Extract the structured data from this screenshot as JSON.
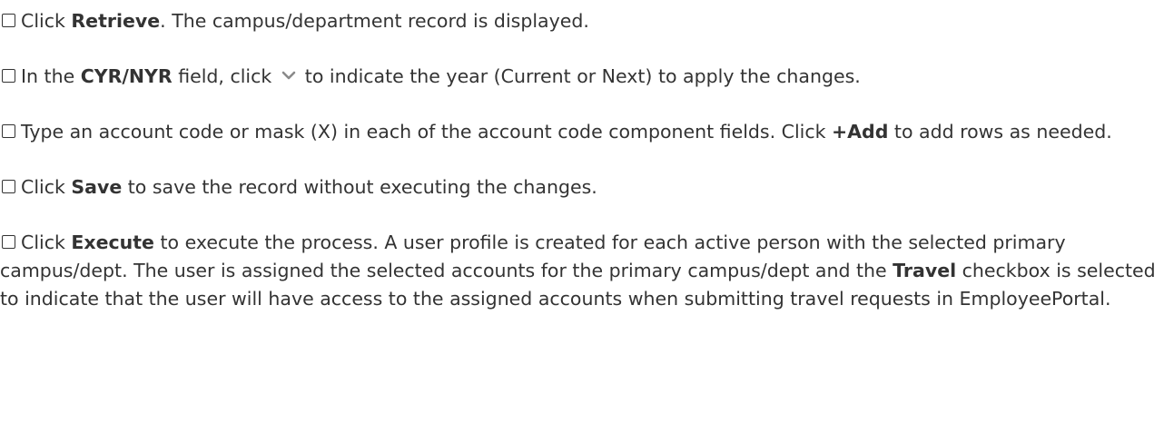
{
  "steps": [
    {
      "id": "retrieve",
      "pre": "Click ",
      "bold": "Retrieve",
      "post": ". The campus/department record is displayed."
    },
    {
      "id": "cyr-nyr",
      "pre": "In the ",
      "bold": "CYR/NYR",
      "mid": " field, click ",
      "icon": "chevron-down-icon",
      "post": "to indicate the year (Current or Next) to apply the changes."
    },
    {
      "id": "account-code",
      "pre": "Type an account code or mask (X) in each of the account code component fields. Click ",
      "bold": "+Add",
      "post": " to add rows as needed."
    },
    {
      "id": "save",
      "pre": "Click ",
      "bold": "Save",
      "post": " to save the record without executing the changes."
    },
    {
      "id": "execute",
      "pre": "Click ",
      "bold": "Execute",
      "mid": " to execute the process. A user profile is created for each active person with the selected primary campus/dept. The user is assigned the selected accounts for the primary campus/dept and the ",
      "bold2": "Travel",
      "post": " checkbox is selected to indicate that the user will have access to the assigned accounts when submitting travel requests in EmployeePortal."
    }
  ],
  "colors": {
    "text": "#333333",
    "chevron": "#8a8a8a",
    "background": "#ffffff"
  }
}
